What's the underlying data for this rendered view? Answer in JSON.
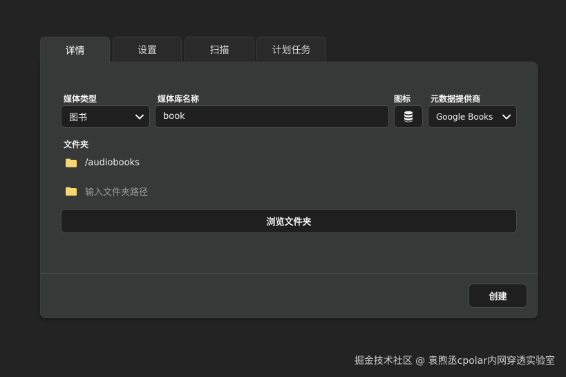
{
  "tabs": [
    {
      "label": "详情",
      "active": true
    },
    {
      "label": "设置",
      "active": false
    },
    {
      "label": "扫描",
      "active": false
    },
    {
      "label": "计划任务",
      "active": false
    }
  ],
  "form": {
    "media_type_label": "媒体类型",
    "media_type_value": "图书",
    "library_name_label": "媒体库名称",
    "library_name_value": "book",
    "icon_label": "图标",
    "icon_value": "database-icon",
    "metadata_label": "元数据提供商",
    "metadata_value": "Google Books",
    "folders_label": "文件夹",
    "folders": [
      "/audiobooks"
    ],
    "folder_input_placeholder": "输入文件夹路径",
    "browse_label": "浏览文件夹",
    "create_label": "创建"
  },
  "colors": {
    "background": "#232323",
    "panel": "#373838",
    "control": "#1f1f1f",
    "folder": "#f7d774"
  },
  "watermark": "掘金技术社区 @ 袁煦丞cpolar内网穿透实验室"
}
